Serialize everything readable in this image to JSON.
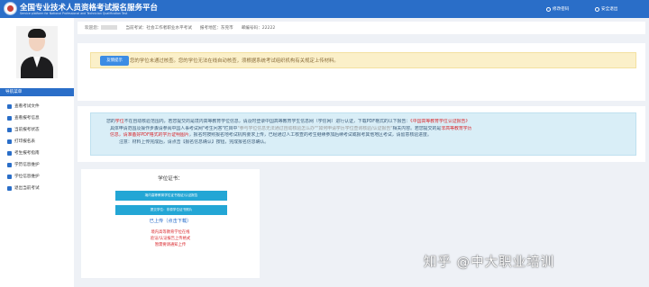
{
  "header": {
    "title": "全国专业技术人员资格考试报名服务平台",
    "subtitle": "Service platform for National Professional and Technician Qualification Test",
    "links": [
      {
        "label": "修改密码",
        "icon": "key-icon"
      },
      {
        "label": "安全退出",
        "icon": "logout-icon"
      }
    ]
  },
  "sidebar": {
    "menu_header": "导航菜单",
    "items": [
      {
        "label": "查看考试文件"
      },
      {
        "label": "查看报考信息"
      },
      {
        "label": "当前报考状态"
      },
      {
        "label": "打印报名表"
      },
      {
        "label": "考生报考指南"
      },
      {
        "label": "学历信息维护"
      },
      {
        "label": "学位信息维护"
      },
      {
        "label": "退出当前考试"
      }
    ]
  },
  "infobar": {
    "welcome": "欢迎您：",
    "exam": "当前考试：",
    "exam_value": "社会工作者职业水平考试",
    "area": "报考地区：",
    "area_value": "东莞市",
    "code": "邮编号码：",
    "code_value": "22222"
  },
  "notice1": {
    "button": "友情提示",
    "text": "您的学位未通过核查。您的学位无法在线自动核查，须根据系统考试组织机构有关规定上传材料。"
  },
  "notice2": {
    "l1_a": "您的",
    "l1_b": "学位",
    "l1_c": "不在自动核验范围内，若您提交的是境内高等教育学位信息，请及时登录中国高等教育学生信息网（学信网）进行认证，下载PDF格式的以下报告：",
    "l1_d": "《中国高等教育学位认证报告》",
    "l2_a": "具体申请范围及操作步骤请参阅中国人事考试网\"考生问答\"栏目中",
    "l2_b": "\"参与学位信息无法通过自动核验怎么办\"",
    "l2_c": "\"如何申请学历学位查询核验/认证报告\"",
    "l2_d": "相关内容。若您提交的是",
    "l2_e": "非高等教育学历",
    "l3_a": "信息，请准备好PDF格式的学历证明图片",
    "l3_b": "，报名时按照报名地考试机构要求上传，已经通过人工核查的考生继续参加后续考试或报考其他地区考试，请留意核验进度。",
    "l4": "注意：材料上传完成后，请点击【报名信息确认】按钮，完成报名信息确认。"
  },
  "cert": {
    "title": "学位证书：",
    "btn1": "境内高等教育学位证书验证/认证报告",
    "btn2": "提交学位：非原学位证书照片",
    "link": "已上传（点击下载）",
    "red1": "境内高等教育学位在线",
    "red2": "验证/认证报告上传格式",
    "red3": "暂需要请通知上传"
  },
  "watermark": "知乎 @中大职业培训"
}
